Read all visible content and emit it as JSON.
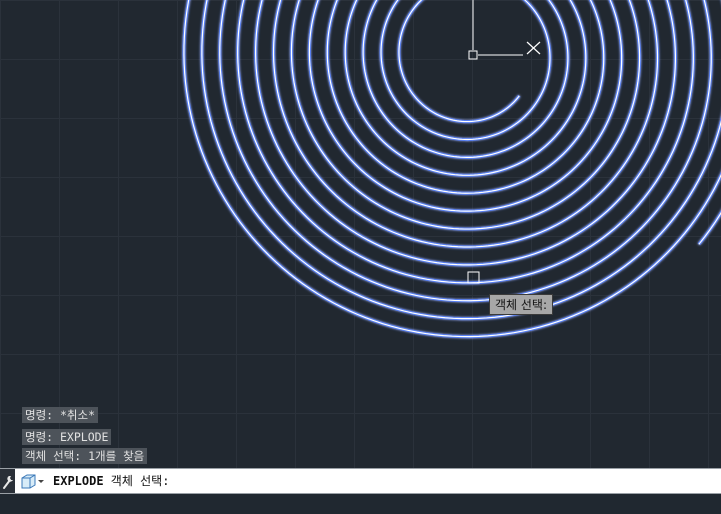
{
  "canvas": {
    "background": "#212830",
    "grid_color": "#2b323b",
    "spiral_color": "#ffffff",
    "spiral_glow": "#4a7cff",
    "crosshair_color": "#ffffff"
  },
  "tooltip": {
    "label": "객체 선택:"
  },
  "command_history": [
    "명령: *취소*",
    "명령: EXPLODE",
    "객체 선택: 1개를 찾음"
  ],
  "command_line": {
    "command": "EXPLODE",
    "prompt": " 객체 선택:"
  },
  "icons": {
    "settings": "wrench-icon",
    "command": "command-cube-icon"
  }
}
